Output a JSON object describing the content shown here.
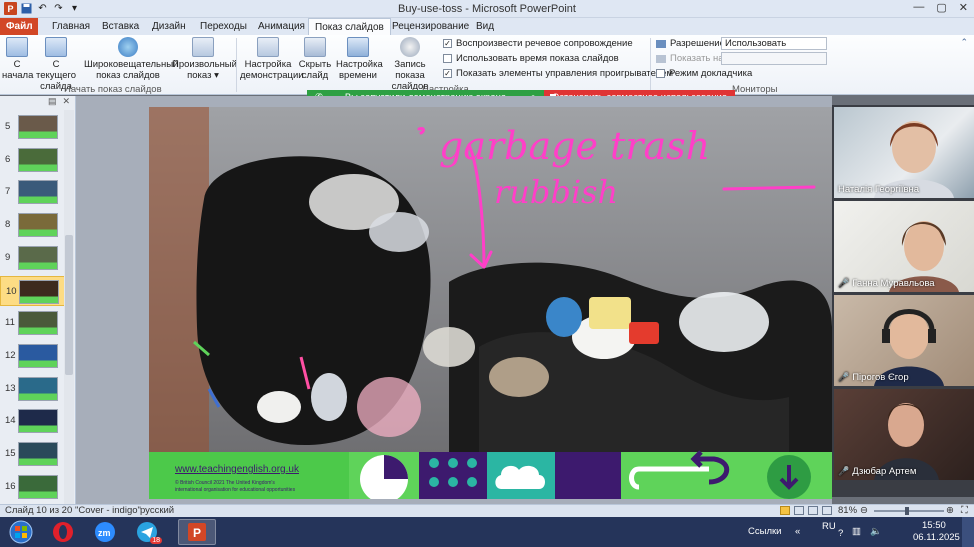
{
  "window": {
    "title": "Buy-use-toss  -  Microsoft PowerPoint"
  },
  "ribbon_tabs": [
    {
      "label": "Файл"
    },
    {
      "label": "Главная"
    },
    {
      "label": "Вставка"
    },
    {
      "label": "Дизайн"
    },
    {
      "label": "Переходы"
    },
    {
      "label": "Анимация"
    },
    {
      "label": "Показ слайдов"
    },
    {
      "label": "Рецензирование"
    },
    {
      "label": "Вид"
    }
  ],
  "ribbon": {
    "start": {
      "from_start": "С начала",
      "from_current": "С текущего слайда",
      "broadcast": "Широковещательный показ слайдов",
      "custom": "Произвольный показ",
      "group_label": "Начать показ слайдов"
    },
    "setup": {
      "setup_show": "Настройка демонстрации",
      "hide_slide": "Скрыть слайд",
      "rehearse": "Настройка времени",
      "record": "Запись показа слайдов",
      "play_narration": "Воспроизвести речевое сопровождение",
      "use_timings": "Использовать время показа слайдов",
      "show_controls": "Показать элементы управления проигрывателем",
      "group_label": "Настройка"
    },
    "monitors": {
      "resolution_label": "Разрешение:",
      "resolution_value": "Использовать текуще...",
      "show_on_label": "Показать на:",
      "presenter_view": "Режим докладчика",
      "group_label": "Мониторы"
    }
  },
  "share_bar": {
    "status": "Вы запустили демонстрацию экрана",
    "stop": "Остановить совместное использование"
  },
  "slides_panel": {
    "selected": 10,
    "slides": [
      5,
      6,
      7,
      8,
      9,
      10,
      11,
      12,
      13,
      14,
      15,
      16
    ]
  },
  "slide": {
    "annotation_line1": "garbage trash",
    "annotation_line2": "rubbish",
    "footer_url": "www.teachingenglish.org.uk",
    "footer_copyright1": "© British Council 2021 The United Kingdom's",
    "footer_copyright2": "international organisation for educational opportunities"
  },
  "participants": [
    {
      "name": "Наталія Георгіївна",
      "muted": false
    },
    {
      "name": "Ганна Муравльова",
      "muted": true
    },
    {
      "name": "Пірогов Єгор",
      "muted": true
    },
    {
      "name": "Дзюбар Артем",
      "muted": true
    }
  ],
  "statusbar": {
    "slide_info": "Слайд 10 из 20",
    "theme": "\"Cover - indigo\"",
    "language": "русский",
    "zoom": "81%"
  },
  "taskbar": {
    "links_label": "Ссылки",
    "language": "RU",
    "time": "15:50",
    "date": "06.11.2025",
    "telegram_badge": "18"
  },
  "colors": {
    "accent_pink": "#ff3fc8",
    "slide_green": "#5fd35a",
    "slide_purple": "#3d1a6e",
    "share_green": "#2ea043",
    "share_red": "#e03434"
  }
}
